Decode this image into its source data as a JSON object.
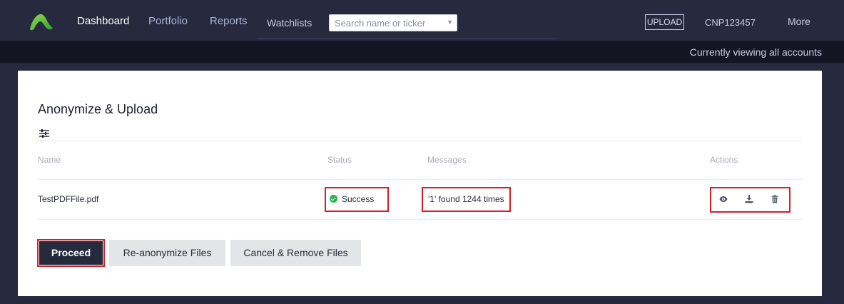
{
  "nav": {
    "logo": "logo-icon",
    "links": [
      "Dashboard",
      "Portfolio",
      "Reports",
      "Watchlists"
    ],
    "active": "Dashboard",
    "search_placeholder": "Search name or ticker",
    "upload_label": "UPLOAD",
    "account_id": "CNP123457",
    "more_label": "More"
  },
  "subbar": {
    "viewing": "Currently viewing all accounts"
  },
  "page": {
    "title": "Anonymize & Upload",
    "filter_icon": "sliders-icon",
    "columns": [
      "Name",
      "Status",
      "Messages",
      "Actions"
    ],
    "rows": [
      {
        "name": "TestPDFFile.pdf",
        "status": "Success",
        "message": "'1' found 1244 times",
        "actions": [
          "eye-icon",
          "download-icon",
          "trash-icon"
        ]
      }
    ],
    "buttons": {
      "proceed": "Proceed",
      "reanonymize": "Re-anonymize Files",
      "cancel": "Cancel & Remove Files"
    }
  },
  "colors": {
    "nav_bg": "#272a3e",
    "subbar_bg": "#131522",
    "accent_green": "#7ac943",
    "success_green": "#2bb24c",
    "highlight_red": "#d0202a",
    "primary_button": "#262a3d"
  }
}
